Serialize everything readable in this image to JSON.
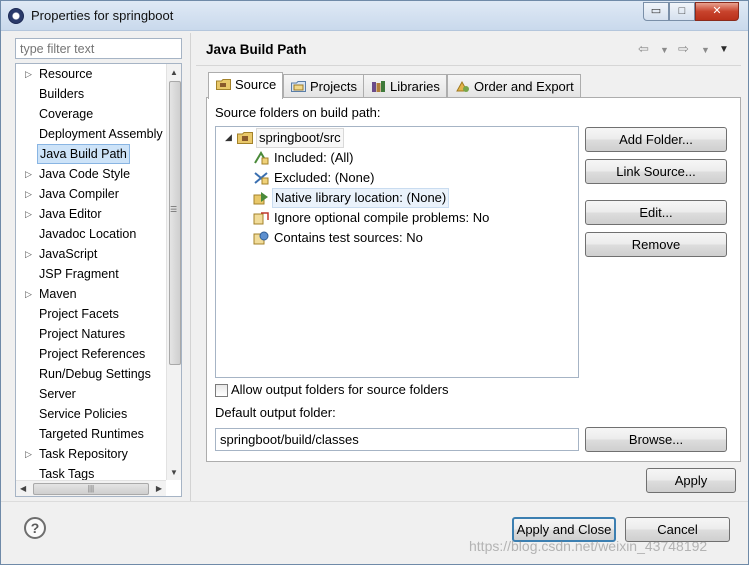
{
  "window": {
    "title": "Properties for springboot",
    "minimize_label": "▭",
    "maximize_label": "□",
    "close_label": "✕"
  },
  "filter": {
    "placeholder": "type filter text"
  },
  "nav": {
    "items": [
      {
        "label": "Resource",
        "expandable": true
      },
      {
        "label": "Builders",
        "expandable": false
      },
      {
        "label": "Coverage",
        "expandable": false
      },
      {
        "label": "Deployment Assembly",
        "expandable": false
      },
      {
        "label": "Java Build Path",
        "expandable": false,
        "selected": true
      },
      {
        "label": "Java Code Style",
        "expandable": true
      },
      {
        "label": "Java Compiler",
        "expandable": true
      },
      {
        "label": "Java Editor",
        "expandable": true
      },
      {
        "label": "Javadoc Location",
        "expandable": false
      },
      {
        "label": "JavaScript",
        "expandable": true
      },
      {
        "label": "JSP Fragment",
        "expandable": false
      },
      {
        "label": "Maven",
        "expandable": true
      },
      {
        "label": "Project Facets",
        "expandable": false
      },
      {
        "label": "Project Natures",
        "expandable": false
      },
      {
        "label": "Project References",
        "expandable": false
      },
      {
        "label": "Run/Debug Settings",
        "expandable": false
      },
      {
        "label": "Server",
        "expandable": false
      },
      {
        "label": "Service Policies",
        "expandable": false
      },
      {
        "label": "Targeted Runtimes",
        "expandable": false
      },
      {
        "label": "Task Repository",
        "expandable": true
      },
      {
        "label": "Task Tags",
        "expandable": false
      }
    ]
  },
  "page": {
    "title": "Java Build Path",
    "tabs": [
      {
        "label": "Source",
        "icon": "source-folder-icon",
        "active": true
      },
      {
        "label": "Projects",
        "icon": "projects-icon"
      },
      {
        "label": "Libraries",
        "icon": "libraries-icon"
      },
      {
        "label": "Order and Export",
        "icon": "order-export-icon"
      }
    ],
    "source_label": "Source folders on build path:",
    "tree": {
      "root": "springboot/src",
      "children": [
        {
          "label": "Included: (All)",
          "icon": "included-icon"
        },
        {
          "label": "Excluded: (None)",
          "icon": "excluded-icon"
        },
        {
          "label": "Native library location: (None)",
          "icon": "native-library-icon",
          "selected": true
        },
        {
          "label": "Ignore optional compile problems: No",
          "icon": "ignore-problems-icon"
        },
        {
          "label": "Contains test sources: No",
          "icon": "test-sources-icon"
        }
      ]
    },
    "buttons": {
      "add_folder": "Add Folder...",
      "link_source": "Link Source...",
      "edit": "Edit...",
      "remove": "Remove",
      "browse": "Browse..."
    },
    "allow_output_label": "Allow output folders for source folders",
    "allow_output_checked": false,
    "default_output_label": "Default output folder:",
    "default_output_value": "springboot/build/classes"
  },
  "footer": {
    "apply": "Apply",
    "apply_close": "Apply and Close",
    "cancel": "Cancel",
    "help": "?"
  },
  "watermark": "https://blog.csdn.net/weixin_43748192"
}
